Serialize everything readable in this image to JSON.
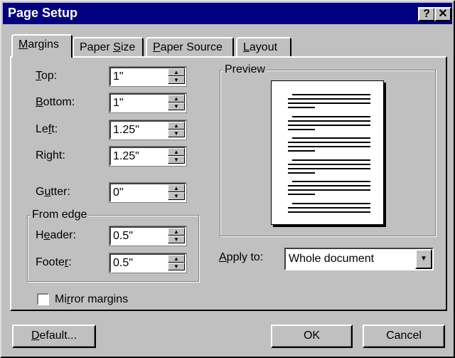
{
  "window": {
    "title": "Page Setup",
    "help_label": "?",
    "close_label": "✕"
  },
  "tabs": [
    {
      "label": "Margins",
      "mnemonic": "M",
      "rest": "argins",
      "active": true
    },
    {
      "label": "Paper Size",
      "pre": "Paper ",
      "mnemonic": "S",
      "rest": "ize",
      "active": false
    },
    {
      "label": "Paper Source",
      "pre": "",
      "mnemonic": "P",
      "rest": "aper Source",
      "active": false
    },
    {
      "label": "Layout",
      "pre": "",
      "mnemonic": "L",
      "rest": "ayout",
      "active": false
    }
  ],
  "margins": {
    "top": {
      "pre": "",
      "mn": "T",
      "rest": "op:",
      "value": "1\""
    },
    "bottom": {
      "pre": "",
      "mn": "B",
      "rest": "ottom:",
      "value": "1\""
    },
    "left": {
      "pre": "Le",
      "mn": "f",
      "rest": "t:",
      "value": "1.25\""
    },
    "right": {
      "pre": "Ri",
      "mn": "g",
      "rest": "ht:",
      "value": "1.25\""
    },
    "gutter": {
      "pre": "G",
      "mn": "u",
      "rest": "tter:",
      "value": "0\""
    }
  },
  "from_edge": {
    "title": "From edge",
    "header": {
      "pre": "H",
      "mn": "e",
      "rest": "ader:",
      "value": "0.5\""
    },
    "footer": {
      "pre": "Foote",
      "mn": "r",
      "rest": ":",
      "value": "0.5\""
    }
  },
  "mirror_margins": {
    "pre": "Mi",
    "mn": "r",
    "rest": "ror margins",
    "checked": false
  },
  "preview": {
    "title": "Preview",
    "paragraphs": 6
  },
  "apply_to": {
    "pre": "",
    "mn": "A",
    "rest": "pply to:",
    "value": "Whole document"
  },
  "buttons": {
    "default": {
      "mn": "D",
      "rest": "efault..."
    },
    "ok": "OK",
    "cancel": "Cancel"
  },
  "spin_up": "▲",
  "spin_down": "▼",
  "dropdown_arrow": "▼"
}
